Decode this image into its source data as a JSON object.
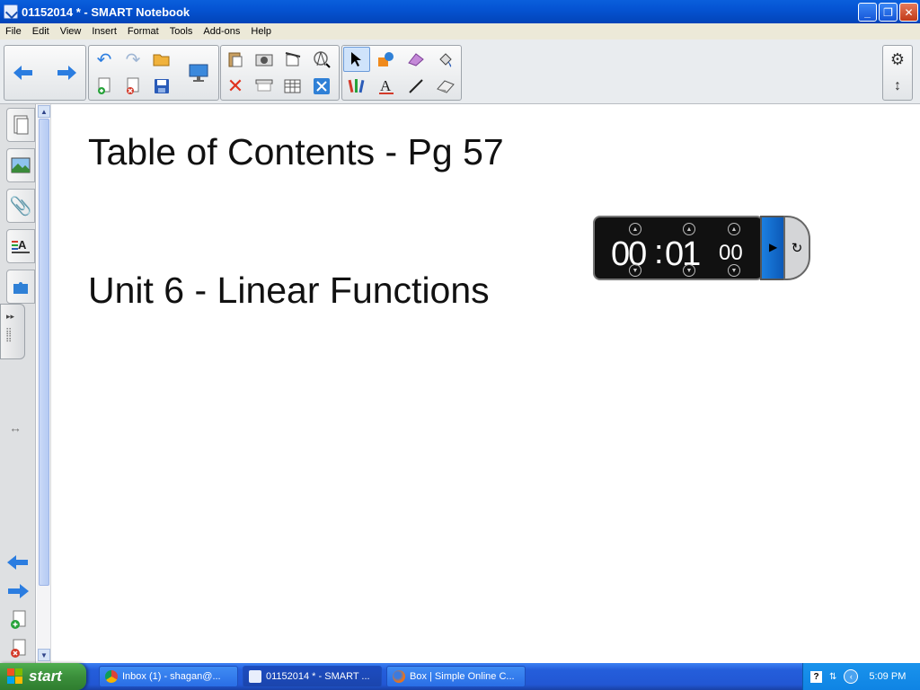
{
  "window": {
    "title": "01152014 * - SMART Notebook",
    "minimize": "_",
    "restore": "❐",
    "close": "✕"
  },
  "menu": [
    "File",
    "Edit",
    "View",
    "Insert",
    "Format",
    "Tools",
    "Add-ons",
    "Help"
  ],
  "toolbar": {
    "groups": [
      {
        "name": "navigation",
        "icons": [
          "back-arrow-icon",
          "forward-arrow-icon"
        ]
      },
      {
        "name": "page",
        "icons": [
          "undo-icon",
          "redo-icon",
          "open-file-icon",
          "add-page-icon",
          "delete-page-icon",
          "save-icon",
          "screen-display-icon"
        ]
      },
      {
        "name": "edit",
        "icons": [
          "paste-icon",
          "camera-icon",
          "clear-page-icon",
          "measurement-tools-icon",
          "delete-icon",
          "screen-shade-icon",
          "table-icon",
          "fullscreen-icon"
        ]
      },
      {
        "name": "tools",
        "icons": [
          "select-icon",
          "shapes-icon",
          "eraser-pink-icon",
          "fill-icon",
          "pens-icon",
          "text-icon",
          "line-icon",
          "eraser-icon"
        ]
      }
    ],
    "right_icons": [
      "settings-gear-icon",
      "move-toolbar-icon"
    ]
  },
  "sidebar": {
    "tabs": [
      "page-sorter-icon",
      "gallery-icon",
      "attachments-icon",
      "properties-icon",
      "addons-icon"
    ],
    "collapse_label": "▸▸"
  },
  "page": {
    "heading": "Table of Contents - Pg 57",
    "subheading": "Unit 6 - Linear Functions"
  },
  "timer": {
    "minutes": "00",
    "colon": ":",
    "seconds": "01",
    "hundredths": "00"
  },
  "taskbar": {
    "start_label": "start",
    "tasks": [
      {
        "label": "Inbox (1) - shagan@...",
        "icon": "chrome-icon"
      },
      {
        "label": "01152014 * - SMART ...",
        "icon": "smart-notebook-icon"
      },
      {
        "label": "Box | Simple Online C...",
        "icon": "firefox-icon"
      }
    ],
    "clock": "5:09 PM"
  }
}
